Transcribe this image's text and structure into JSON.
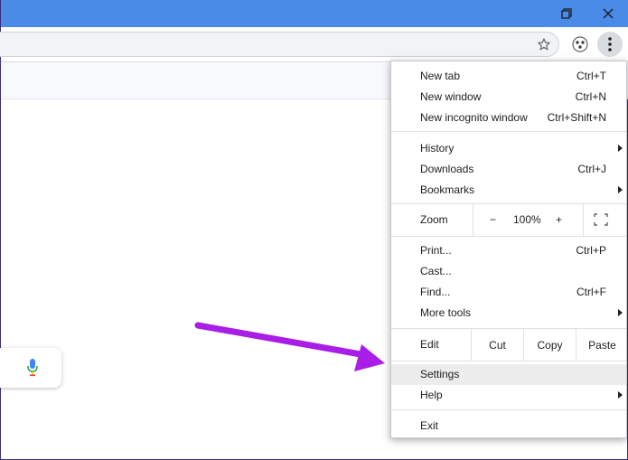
{
  "window": {
    "accent": "#4a8be7",
    "controls": [
      "restore-icon",
      "close-icon"
    ]
  },
  "toolbar": {
    "icons": [
      "star-icon",
      "extension-icon",
      "more-vert-icon"
    ]
  },
  "menu": {
    "new_tab": {
      "label": "New tab",
      "shortcut": "Ctrl+T"
    },
    "new_window": {
      "label": "New window",
      "shortcut": "Ctrl+N"
    },
    "new_incognito": {
      "label": "New incognito window",
      "shortcut": "Ctrl+Shift+N"
    },
    "history": {
      "label": "History"
    },
    "downloads": {
      "label": "Downloads",
      "shortcut": "Ctrl+J"
    },
    "bookmarks": {
      "label": "Bookmarks"
    },
    "zoom": {
      "label": "Zoom",
      "minus": "−",
      "value": "100%",
      "plus": "+"
    },
    "print": {
      "label": "Print...",
      "shortcut": "Ctrl+P"
    },
    "cast": {
      "label": "Cast..."
    },
    "find": {
      "label": "Find...",
      "shortcut": "Ctrl+F"
    },
    "more_tools": {
      "label": "More tools"
    },
    "edit": {
      "label": "Edit",
      "cut": "Cut",
      "copy": "Copy",
      "paste": "Paste"
    },
    "settings": {
      "label": "Settings"
    },
    "help": {
      "label": "Help"
    },
    "exit": {
      "label": "Exit"
    }
  },
  "annotation": {
    "color": "#a81ee6",
    "points_to": "Settings"
  }
}
